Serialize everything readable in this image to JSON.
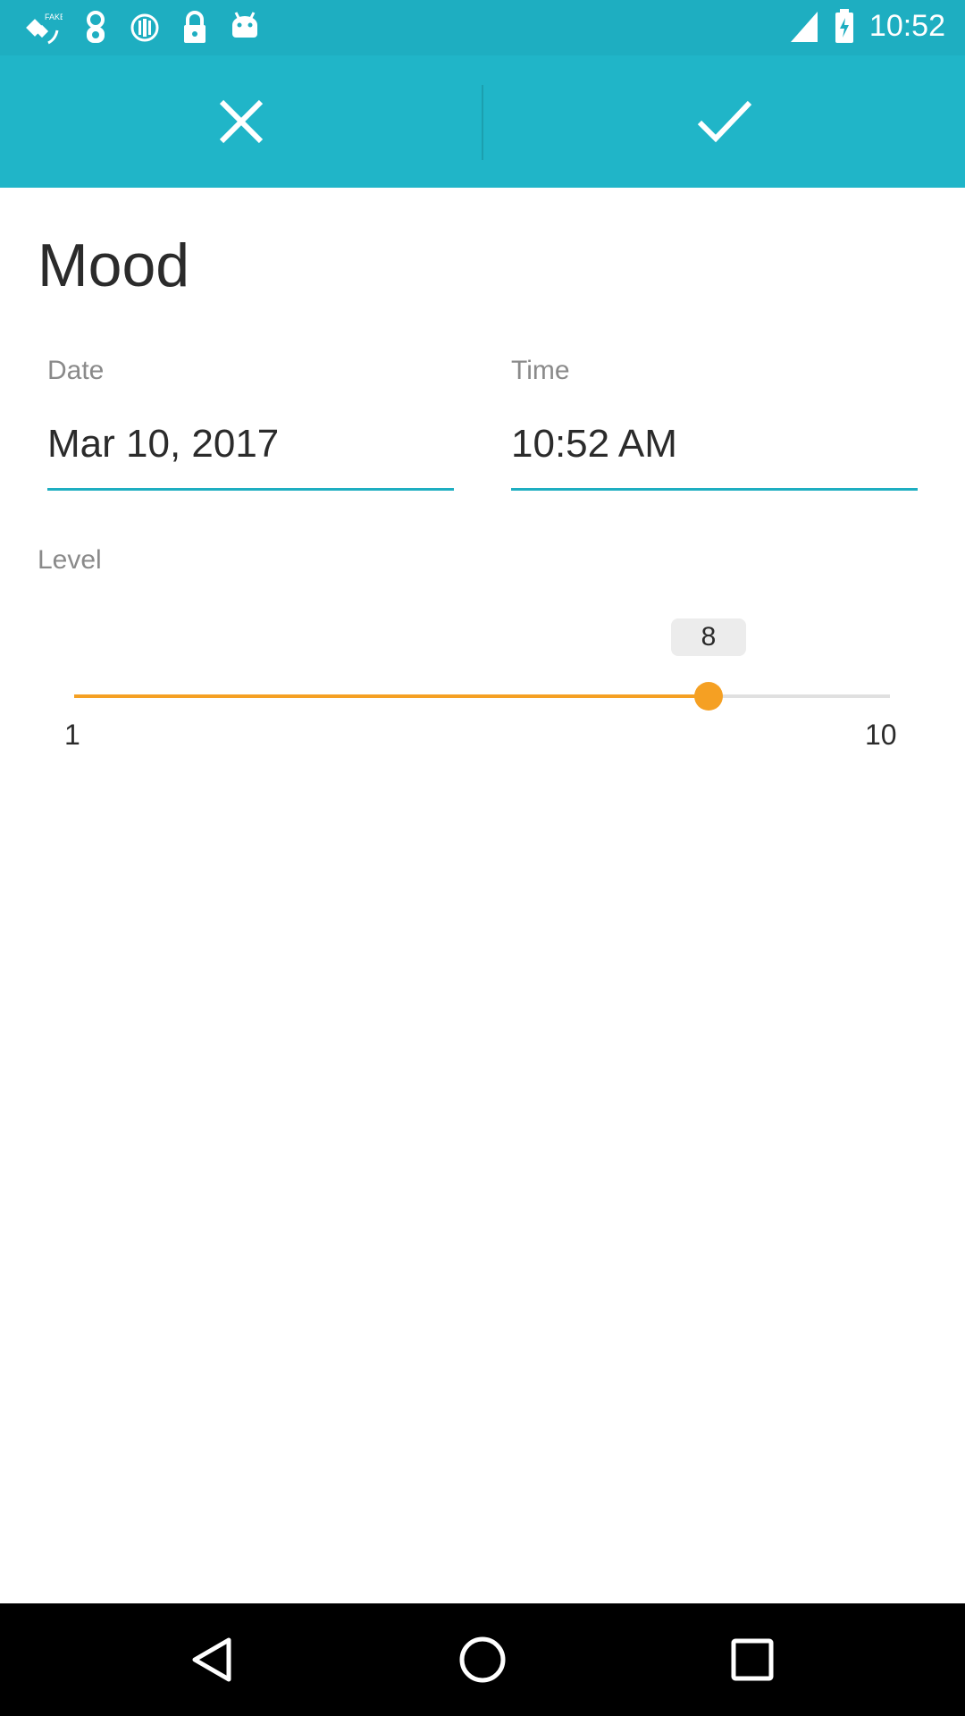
{
  "status_bar": {
    "time": "10:52",
    "icons": [
      "satellite-icon",
      "key-icon",
      "info-icon",
      "lock-icon",
      "android-icon",
      "signal-icon",
      "battery-icon"
    ]
  },
  "toolbar": {
    "cancel_icon": "close-icon",
    "confirm_icon": "check-icon"
  },
  "form": {
    "title": "Mood",
    "date_label": "Date",
    "date_value": "Mar 10, 2017",
    "time_label": "Time",
    "time_value": "10:52 AM",
    "level_label": "Level",
    "level": {
      "min_label": "1",
      "max_label": "10",
      "value_label": "8",
      "min": 1,
      "max": 10,
      "value": 8
    }
  },
  "colors": {
    "accent": "#1eaec1",
    "toolbar": "#20b5c8",
    "slider": "#f5a023"
  },
  "nav_bar": {
    "icons": [
      "back-icon",
      "home-icon",
      "recents-icon"
    ]
  }
}
